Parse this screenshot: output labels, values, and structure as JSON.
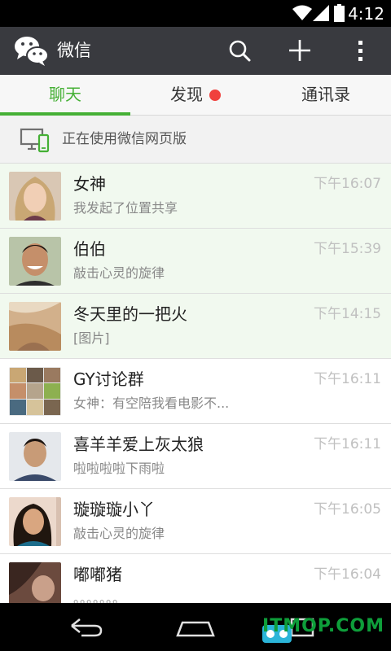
{
  "status_bar": {
    "time": "4:12",
    "icons": [
      "wifi-icon",
      "signal-icon",
      "battery-icon"
    ]
  },
  "app_bar": {
    "title": "微信",
    "icons": [
      "wechat-logo-icon",
      "search-icon",
      "add-icon",
      "more-icon"
    ]
  },
  "tabs": [
    {
      "label": "聊天",
      "active": true
    },
    {
      "label": "发现",
      "badge_dot": true
    },
    {
      "label": "通讯录"
    }
  ],
  "web_notice": {
    "text": "正在使用微信网页版",
    "icon": "desktop-phone-icon"
  },
  "chats": [
    {
      "name": "女神",
      "message": "我发起了位置共享",
      "time": "下午16:07",
      "pinned": true
    },
    {
      "name": "伯伯",
      "message": "敲击心灵的旋律",
      "time": "下午15:39",
      "pinned": true
    },
    {
      "name": "冬天里的一把火",
      "message": "[图片]",
      "time": "下午14:15",
      "pinned": true
    },
    {
      "name": "GY讨论群",
      "message": "女神：有空陪我看电影不...",
      "time": "下午16:11",
      "pinned": false
    },
    {
      "name": "喜羊羊爱上灰太狼",
      "message": "啦啦啦啦下雨啦",
      "time": "下午16:11",
      "pinned": false
    },
    {
      "name": "璇璇璇小丫",
      "message": "敲击心灵的旋律",
      "time": "下午16:05",
      "pinned": false
    },
    {
      "name": "嘟嘟猪",
      "message": "。。。。。。。",
      "time": "下午16:04",
      "pinned": false
    }
  ],
  "nav_bar": {
    "icons": [
      "back-icon",
      "home-icon",
      "recent-apps-icon"
    ],
    "watermark": "ITMOP.COM"
  },
  "colors": {
    "accent": "#45b035",
    "action_bar": "#393a3f",
    "badge": "#f0413d",
    "pinned_bg": "#f1f9ef"
  }
}
